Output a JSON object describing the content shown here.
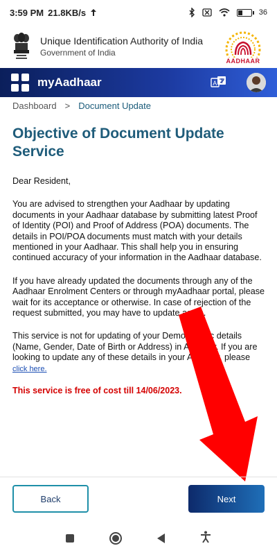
{
  "status_bar": {
    "time": "3:59 PM",
    "speed": "21.8KB/s",
    "battery": "36"
  },
  "header": {
    "org_name": "Unique Identification Authority of India",
    "org_sub": "Government of India",
    "logo_text": "AADHAAR"
  },
  "app_bar": {
    "title": "myAadhaar",
    "lang_icon": "translate-icon",
    "avatar_icon": "avatar"
  },
  "breadcrumb": {
    "home": "Dashboard",
    "separator": ">",
    "current": "Document Update"
  },
  "content": {
    "title": "Objective of Document Update Service",
    "greeting": "Dear Resident,",
    "para1": "You are advised to strengthen your Aadhaar by updating documents in your Aadhaar database by submitting latest Proof of Identity (POI) and Proof of Address (POA) documents. The details in POI/POA documents must match with your details mentioned in your Aadhaar. This shall help you in ensuring continued accuracy of your information in the Aadhaar database.",
    "para2": "If you have already updated the documents through any of the Aadhaar Enrolment Centers or through myAadhaar portal, please wait for its acceptance or otherwise. In case of rejection of the request submitted, you may have to update again.",
    "para3": "This service is not for updating of your Demographic details (Name, Gender, Date of Birth or Address) in Aadhaar. If you are looking to update any of these details in your Aadhaar, please",
    "link": "click here.",
    "free_notice": "This service is free of cost till 14/06/2023."
  },
  "buttons": {
    "back": "Back",
    "next": "Next"
  },
  "colors": {
    "app_bar": "#1c3aa0",
    "title": "#1f5c7a",
    "notice": "#d40000",
    "annotation_arrow": "#ff0000"
  },
  "battery_level": 0.36
}
